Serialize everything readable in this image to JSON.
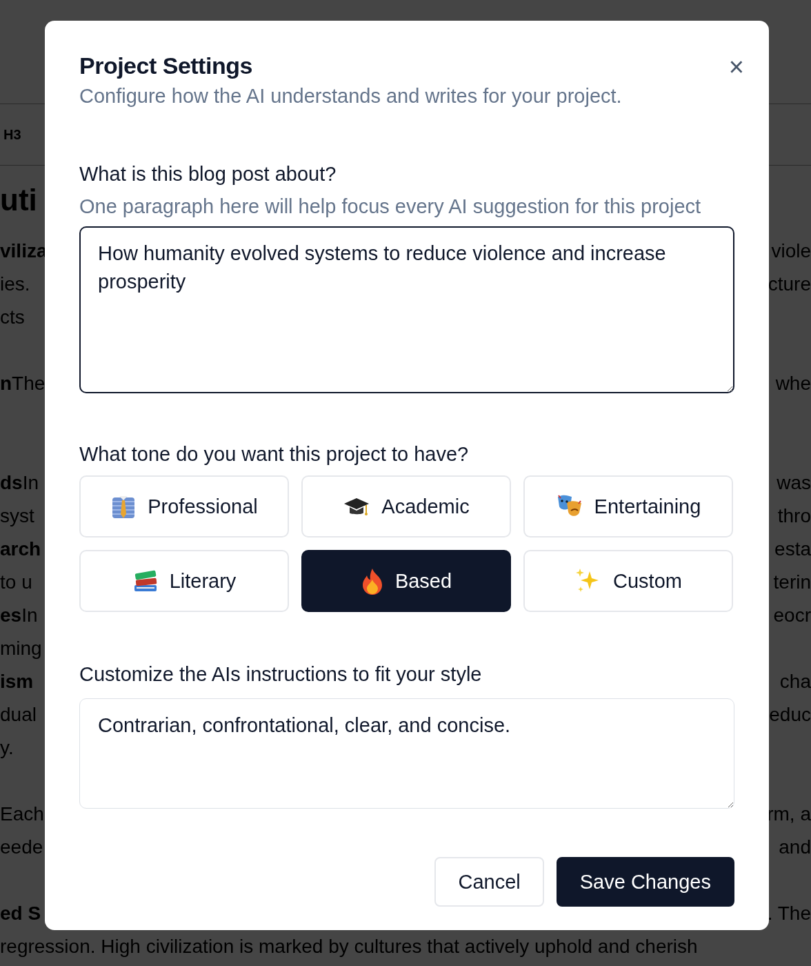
{
  "background": {
    "toolbar": {
      "heading_button": "H3"
    },
    "heading": "uti",
    "blocks": [
      {
        "kind": "paragraph",
        "lines": [
          {
            "left": "**viliza**",
            "right": "viole"
          },
          {
            "left": "ies.",
            "right": "cture"
          },
          {
            "left": "cts"
          }
        ]
      },
      {
        "kind": "paragraph",
        "lines": [
          {
            "left": "**n**The",
            "right": "whe"
          }
        ]
      },
      {
        "kind": "section",
        "lines": [
          {
            "left": "**ds**In",
            "right": "was"
          },
          {
            "left": "syst",
            "right": "thro"
          },
          {
            "left": "**arch**",
            "right": "esta"
          },
          {
            "left": "to u",
            "right": "terin"
          },
          {
            "left": "**es**In",
            "right": "eocr"
          },
          {
            "left": "ming"
          },
          {
            "left": "**ism**",
            "right": "cha"
          },
          {
            "left": "dual",
            "right": "educ"
          },
          {
            "left": "y."
          }
        ]
      },
      {
        "kind": "paragraph",
        "lines": [
          {
            "left": "Each",
            "right": "rm, a"
          },
          {
            "left": "eede",
            "right": "and"
          }
        ]
      },
      {
        "kind": "paragraph",
        "lines": [
          {
            "left": "**ed S**",
            "right": ". The"
          },
          {
            "left": "regression. High civilization is marked by cultures that actively uphold and cherish"
          }
        ]
      }
    ]
  },
  "dialog": {
    "title": "Project Settings",
    "subtitle": "Configure how the AI understands and writes for your project.",
    "close": "×",
    "about": {
      "label": "What is this blog post about?",
      "hint": "One paragraph here will help focus every AI suggestion for this project",
      "value": "How humanity evolved systems to reduce violence and increase prosperity",
      "focused": true
    },
    "tone": {
      "label": "What tone do you want this project to have?",
      "options": [
        {
          "label": "Professional",
          "selected": false
        },
        {
          "label": "Academic",
          "selected": false
        },
        {
          "label": "Entertaining",
          "selected": false
        },
        {
          "label": "Literary",
          "selected": false
        },
        {
          "label": "Based",
          "selected": true
        },
        {
          "label": "Custom",
          "selected": false
        }
      ]
    },
    "instructions": {
      "label": "Customize the AIs instructions to fit your style",
      "value": "Contrarian, confrontational, clear, and concise.",
      "focused": false
    },
    "buttons": [
      {
        "label": "Cancel",
        "kind": "secondary"
      },
      {
        "label": "Save Changes",
        "kind": "primary"
      }
    ]
  }
}
